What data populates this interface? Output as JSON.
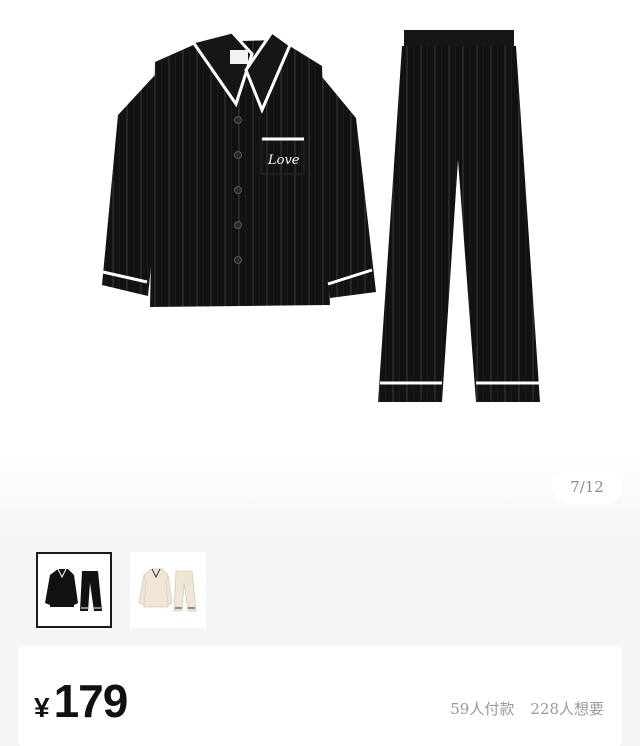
{
  "gallery": {
    "page_indicator": "7/12",
    "pocket_text": "Love",
    "thumbnails": [
      {
        "label": "black-pajama-set",
        "selected": true
      },
      {
        "label": "beige-pajama-set",
        "selected": false
      }
    ]
  },
  "price": {
    "currency": "¥",
    "amount": "179"
  },
  "stats": {
    "paid": "59人付款",
    "wanted": "228人想要"
  },
  "colors": {
    "garment_black": "#111111",
    "piping_white": "#ffffff",
    "beige": "#efe6d6"
  }
}
